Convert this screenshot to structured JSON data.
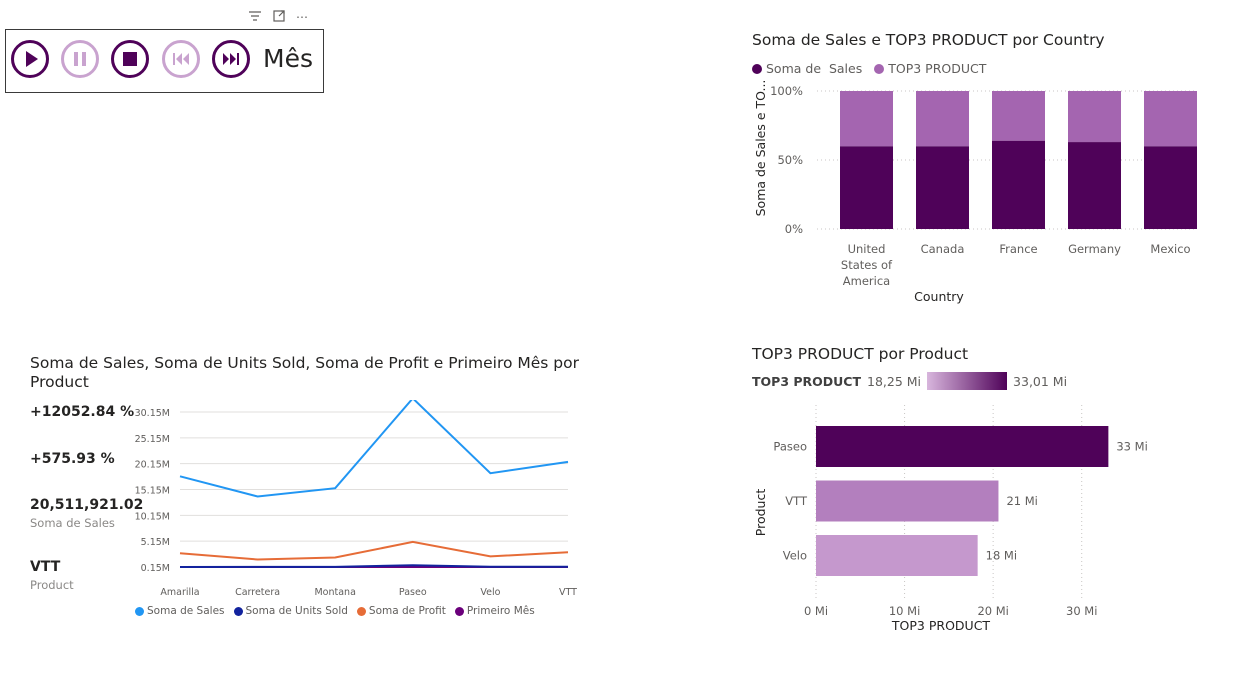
{
  "player": {
    "label": "Mês",
    "buttons": [
      "play",
      "pause",
      "stop",
      "skip-back",
      "skip-forward"
    ]
  },
  "toolbar": {
    "filter_icon": "filter-icon",
    "focus_icon": "focus-mode-icon",
    "more_icon": "more-options-icon",
    "more_glyph": "⋯"
  },
  "colors": {
    "dark_purple": "#4f0259",
    "mid_purple": "#a465b0",
    "sales_blue": "#2196f3",
    "units_navy": "#12239e",
    "profit_orange": "#e66c37",
    "primeiro_purple": "#6b007b"
  },
  "chart_data": [
    {
      "type": "bar",
      "stacked": "100%",
      "title": "Soma de Sales e TOP3 PRODUCT por Country",
      "xlabel": "Country",
      "ylabel": "Soma de Sales e TO...",
      "legend_placement": "top-left",
      "categories": [
        "United States of America",
        "Canada",
        "France",
        "Germany",
        "Mexico"
      ],
      "category_lines": [
        [
          "United",
          "States of",
          "America"
        ],
        [
          "Canada"
        ],
        [
          "France"
        ],
        [
          "Germany"
        ],
        [
          "Mexico"
        ]
      ],
      "yticks": [
        "100%",
        "50%",
        "0%"
      ],
      "series": [
        {
          "name": "Soma de  Sales",
          "values": [
            60,
            60,
            64,
            63,
            60
          ],
          "color": "#4f0259"
        },
        {
          "name": "TOP3 PRODUCT",
          "values": [
            40,
            40,
            36,
            37,
            40
          ],
          "color": "#a465b0"
        }
      ],
      "grid": true
    },
    {
      "type": "line",
      "title": "Soma de Sales, Soma de Units Sold, Soma de Profit e Primeiro Mês por Product",
      "title_lines": [
        "Soma de Sales, Soma de Units Sold, Soma de Profit e Primeiro Mês por",
        "Product"
      ],
      "x": [
        "Amarilla",
        "Carretera",
        "Montana",
        "Paseo",
        "Velo",
        "VTT"
      ],
      "yticks": [
        "30.15M",
        "25.15M",
        "20.15M",
        "15.15M",
        "10.15M",
        "5.15M",
        "0.15M"
      ],
      "ylim": [
        0.15,
        30.15
      ],
      "legend_placement": "bottom",
      "series": [
        {
          "name": "Soma de Sales",
          "values": [
            17.7,
            13.8,
            15.4,
            32.8,
            18.3,
            20.5
          ],
          "color": "#2196f3"
        },
        {
          "name": "Soma de Units Sold",
          "values": [
            0.16,
            0.17,
            0.17,
            0.5,
            0.2,
            0.2
          ],
          "color": "#12239e"
        },
        {
          "name": "Soma de Profit",
          "values": [
            2.8,
            1.6,
            2.0,
            5.0,
            2.2,
            3.0
          ],
          "color": "#e66c37"
        },
        {
          "name": "Primeiro Mês",
          "values": [
            0.15,
            0.15,
            0.15,
            0.15,
            0.15,
            0.15
          ],
          "color": "#6b007b"
        }
      ],
      "kpis": [
        {
          "value": "+12052.84 %",
          "label": ""
        },
        {
          "value": "+575.93 %",
          "label": ""
        },
        {
          "value": "20,511,921.02",
          "label": "Soma de Sales"
        },
        {
          "value": "VTT",
          "label": "Product"
        }
      ],
      "grid": true
    },
    {
      "type": "bar",
      "orientation": "horizontal",
      "title": "TOP3 PRODUCT por Product",
      "xlabel": "TOP3 PRODUCT",
      "ylabel": "Product",
      "gradient_legend": {
        "title": "TOP3 PRODUCT",
        "min": "18,25 Mi",
        "max": "33,01 Mi"
      },
      "categories": [
        "Paseo",
        "VTT",
        "Velo"
      ],
      "values": [
        33.01,
        20.6,
        18.25
      ],
      "value_labels": [
        "33 Mi",
        "21 Mi",
        "18 Mi"
      ],
      "bar_colors": [
        "#4f0259",
        "#b37fbe",
        "#c598cd"
      ],
      "xticks": [
        "0 Mi",
        "10 Mi",
        "20 Mi",
        "30 Mi"
      ],
      "xlim": [
        0,
        35
      ],
      "grid": true
    }
  ]
}
